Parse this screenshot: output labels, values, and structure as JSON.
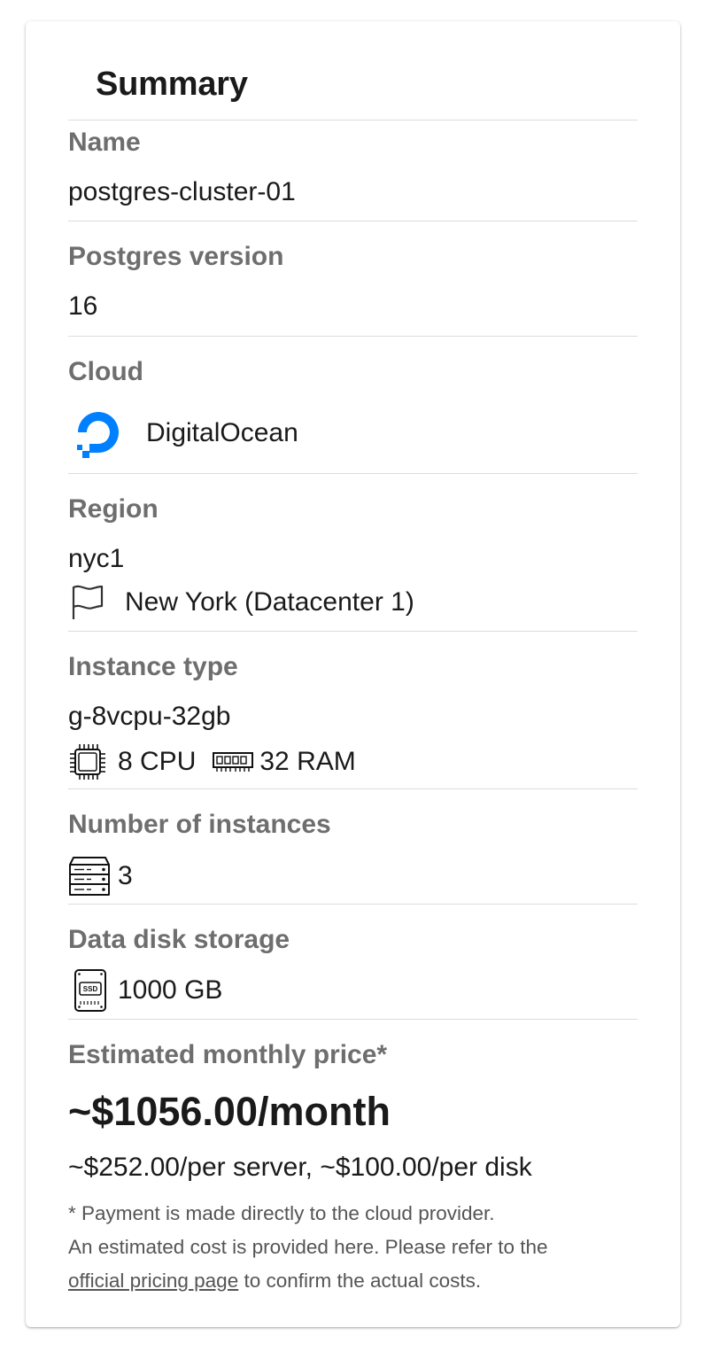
{
  "summary": {
    "title": "Summary",
    "name": {
      "label": "Name",
      "value": "postgres-cluster-01"
    },
    "postgres_version": {
      "label": "Postgres version",
      "value": "16"
    },
    "cloud": {
      "label": "Cloud",
      "value": "DigitalOcean",
      "icon": "digitalocean-logo-icon",
      "color": "#0080ff"
    },
    "region": {
      "label": "Region",
      "code": "nyc1",
      "location": "New York (Datacenter 1)",
      "icon": "flag-icon"
    },
    "instance_type": {
      "label": "Instance type",
      "value": "g-8vcpu-32gb",
      "cpu": "8 CPU",
      "ram": "32 RAM"
    },
    "instances": {
      "label": "Number of instances",
      "value": "3",
      "icon": "server-icon"
    },
    "storage": {
      "label": "Data disk storage",
      "value": "1000 GB",
      "icon": "ssd-icon"
    },
    "price": {
      "label": "Estimated monthly price*",
      "total": "~$1056.00/month",
      "breakdown": "~$252.00/per server, ~$100.00/per disk",
      "note_line1": "* Payment is made directly to the cloud provider.",
      "note_line2": "An estimated cost is provided here. Please refer to the",
      "note_link": "official pricing page",
      "note_line3_rest": " to confirm the actual costs."
    }
  }
}
